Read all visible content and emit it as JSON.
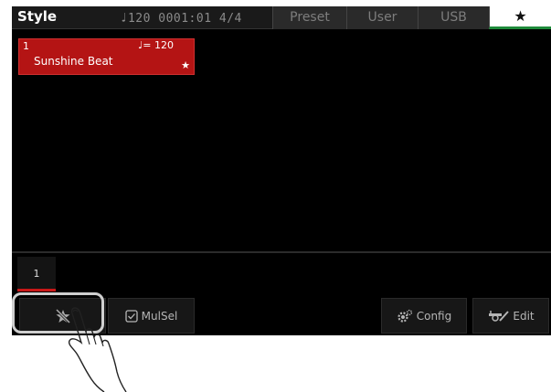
{
  "topbar": {
    "title": "Style",
    "tempo_note": "♩",
    "tempo": "120",
    "position": "0001:01",
    "meter": "4/4",
    "tabs": [
      "Preset",
      "User",
      "USB"
    ],
    "active_tab_icon": "star-icon"
  },
  "style_list": [
    {
      "number": "1",
      "tempo_label": "♩= 120",
      "name": "Sunshine Beat",
      "favorite_icon": "star-icon"
    }
  ],
  "page_tabs": [
    "1"
  ],
  "buttons": {
    "unfavorite_icon": "unstar-icon",
    "mulsel_label": "MulSel",
    "config_label": "Config",
    "edit_label": "Edit"
  },
  "colors": {
    "selected_card": "#b41414",
    "active_tab_accent": "#1e8a3a",
    "page_indicator": "#c81818"
  }
}
